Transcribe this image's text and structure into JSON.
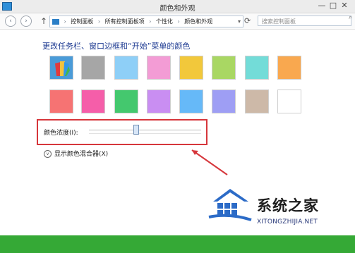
{
  "window": {
    "title": "颜色和外观"
  },
  "toolbar": {
    "back_icon": "back-arrow-icon",
    "forward_icon": "forward-arrow-icon",
    "up_icon": "up-arrow-icon",
    "breadcrumb": [
      "控制面板",
      "所有控制面板项",
      "个性化",
      "颜色和外观"
    ],
    "search_placeholder": "搜索控制面板"
  },
  "content": {
    "heading": "更改任务栏、窗口边框和“开始”菜单的颜色",
    "swatches_row1": [
      "palette",
      "#a6a6a6",
      "#8ecff7",
      "#f39cd5",
      "#f2c83b",
      "#a9d763",
      "#73dcd8",
      "#f9a84f"
    ],
    "swatches_row2": [
      "#f67373",
      "#f55ea9",
      "#44c86e",
      "#c98ef2",
      "#66b9f8",
      "#9e9ef4",
      "#cdb9a8",
      "#ffffff"
    ],
    "opacity_label": "颜色浓度(I):",
    "opacity_value": 0.42,
    "mixer_toggle_label": "显示颜色混合器(X)"
  },
  "watermark": {
    "title": "系统之家",
    "site": "XITONGZHIJIA.NET"
  },
  "colors": {
    "accent": "#35a936",
    "highlight": "#d6363b"
  }
}
